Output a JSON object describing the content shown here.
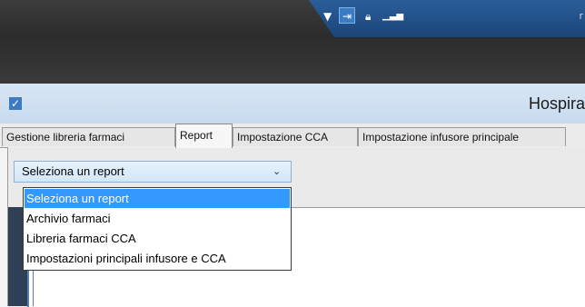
{
  "window": {
    "title_fragment": "Hospira",
    "right_fragment": "r"
  },
  "titlebar_icons": [
    "dropdown-arrow-icon",
    "pin-icon",
    "lock-icon",
    "signal-bars-icon"
  ],
  "tabs": [
    {
      "label": "Gestione libreria farmaci",
      "active": false
    },
    {
      "label": "Report",
      "active": true
    },
    {
      "label": "Impostazione CCA",
      "active": false
    },
    {
      "label": "Impostazione infusore principale",
      "active": false
    }
  ],
  "report_select": {
    "value": "Seleziona un report"
  },
  "report_options": [
    "Seleziona un report",
    "Archivio farmaci",
    "Libreria farmaci CCA",
    "Impostazioni principali infusore e CCA"
  ],
  "colors": {
    "accent_blue": "#3399ff",
    "header_blue": "#c7daee",
    "titlebar_blue": "#1b4478"
  }
}
